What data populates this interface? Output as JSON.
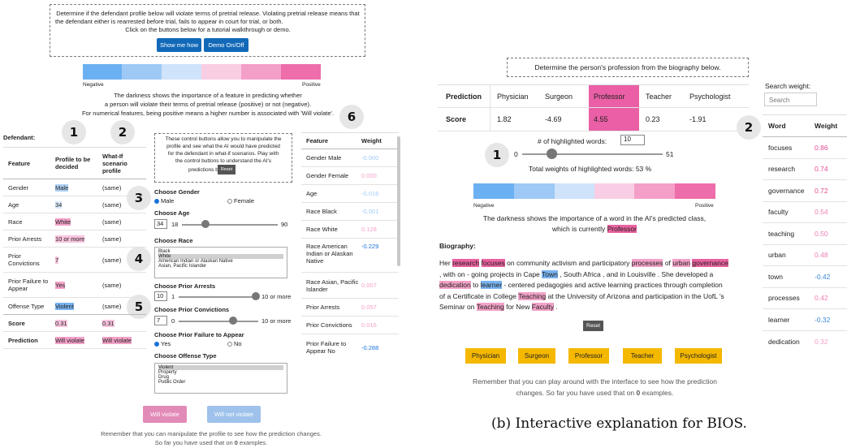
{
  "left": {
    "instructions": {
      "line1": "Determine if the defendant profile below will violate terms of pretrial release. Violating pretrial release means that",
      "line2": "the defendant either is rearrested before trial, fails to appear in court for trial, or both.",
      "line3": "Click on the buttons below for a tutorial walkthrough or demo."
    },
    "show_me_how": "Show me how",
    "demo_toggle": "Demo On/Off",
    "scale": {
      "negative": "Negative",
      "positive": "Positive"
    },
    "darkness_text": {
      "line1": "The darkness shows the importance of a feature in predicting whether",
      "line2": "a person will violate their terms of pretrial release (positive) or not (negative).",
      "line3": "For numerical features, being positive means a higher number is associated with 'Will violate'."
    },
    "defendant_label": "Defendant:",
    "badges": {
      "b1": "1",
      "b2": "2",
      "b3": "3",
      "b4": "4",
      "b5": "5",
      "b6": "6"
    },
    "profile_table": {
      "headers": [
        "Feature",
        "Profile to be decided",
        "What-If scenario profile"
      ],
      "rows": [
        [
          "Gender",
          "Male",
          "(same)"
        ],
        [
          "Age",
          "34",
          "(same)"
        ],
        [
          "Race",
          "White",
          "(same)"
        ],
        [
          "Prior Arrests",
          "10 or more",
          "(same)"
        ],
        [
          "Prior Convictions",
          "7",
          "(same)"
        ],
        [
          "Prior Failure to Appear",
          "Yes",
          "(same)"
        ],
        [
          "Offense Type",
          "Violent",
          "(same)"
        ],
        [
          "Score",
          "0.31",
          "0.31"
        ],
        [
          "Prediction",
          "Will violate",
          "Will violate"
        ]
      ]
    },
    "controls": {
      "hint": {
        "line1": "These control buttons allow you to manipulate the",
        "line2": "profile and see what the AI would have predicted",
        "line3": "for the defendant in what-if scenarios. Play with",
        "line4": "the control buttons to understand the AI's",
        "line5": "predictions better."
      },
      "reset": "Reset",
      "gender_label": "Choose Gender",
      "gender_male": "Male",
      "gender_female": "Female",
      "age_label": "Choose Age",
      "age_value": "34",
      "age_min": "18",
      "age_max": "90",
      "race_label": "Choose Race",
      "race_options": [
        "Black",
        "White",
        "American Indian or Alaskan Native",
        "Asian, Pacific Islander"
      ],
      "arrests_label": "Choose Prior Arrests",
      "arrests_value": "10",
      "arrests_min": "1",
      "arrests_max": "10 or more",
      "convictions_label": "Choose Prior Convictions",
      "convictions_value": "7",
      "convictions_min": "0",
      "convictions_max": "10 or more",
      "fta_label": "Choose Prior Failure to Appear",
      "fta_yes": "Yes",
      "fta_no": "No",
      "offense_label": "Choose Offense Type",
      "offense_options": [
        "Violent",
        "Property",
        "Drug",
        "Public Order"
      ]
    },
    "weights_table": {
      "headers": [
        "Feature",
        "Weight"
      ],
      "rows": [
        [
          "Gender Male",
          "-0.000"
        ],
        [
          "Gender Female",
          "0.000"
        ],
        [
          "Age",
          "-0.016"
        ],
        [
          "Race Black",
          "-0.001"
        ],
        [
          "Race White",
          "0.128"
        ],
        [
          "Race American Indian or Alaskan Native",
          "-0.229"
        ],
        [
          "Race Asian, Pacific Islander",
          "0.007"
        ],
        [
          "Prior Arrests",
          "0.057"
        ],
        [
          "Prior Convictions",
          "0.016"
        ],
        [
          "Prior Failure to Appear No",
          "-0.288"
        ]
      ]
    },
    "will_violate": "Will violate",
    "will_not_violate": "Will not violate",
    "footer": {
      "line1": "Remember that you can manipulate the profile to see how the prediction changes.",
      "line2_pre": "So far you have used that on ",
      "count": "0",
      "line2_post": " examples."
    }
  },
  "right": {
    "instruction": "Determine the person's profession from the biography below.",
    "table": {
      "prediction_label": "Prediction",
      "score_label": "Score",
      "classes": [
        "Physician",
        "Surgeon",
        "Professor",
        "Teacher",
        "Psychologist"
      ],
      "scores": [
        "1.82",
        "-4.69",
        "4.55",
        "0.23",
        "-1.91"
      ]
    },
    "highlight_label": "# of highlighted words:",
    "highlight_value": "10",
    "slider_min": "0",
    "slider_max": "51",
    "total_weights": "Total weights of highlighted words: 53 %",
    "scale": {
      "negative": "Negative",
      "positive": "Positive"
    },
    "darkness_line1": "The darkness shows the importance of a word in the AI's predicted class,",
    "darkness_line2_pre": "which is currently ",
    "darkness_class": "Professor",
    "bio_label": "Biography:",
    "bio": {
      "l1": [
        "Her ",
        "research",
        " ",
        "focuses",
        " on community activism and participatory ",
        "processes",
        " of ",
        "urban",
        " ",
        "governance"
      ],
      "l2": [
        ", with on - going projects in Cape ",
        "Town",
        " , South Africa , and in Louisville . She developed a"
      ],
      "l3": [
        "dedication",
        " to ",
        "learner",
        " - centered pedagogies and active learning practices through completion"
      ],
      "l4": [
        "of a Certificate in College ",
        "Teaching",
        " at the University of Arizona and participation in the UofL 's"
      ],
      "l5": [
        "Seminar on ",
        "Teaching",
        " for New ",
        "Faculty",
        " ."
      ]
    },
    "reset": "Reset",
    "buttons": [
      "Physician",
      "Surgeon",
      "Professor",
      "Teacher",
      "Psychologist"
    ],
    "footer_line1": "Remember that you can play around with the interface to see how the prediction",
    "footer_line2_pre": "changes. So far you have used that on ",
    "footer_count": "0",
    "footer_line2_post": " examples.",
    "search_label": "Search weight:",
    "search_placeholder": "Search",
    "word_table": {
      "headers": [
        "Word",
        "Weight"
      ],
      "rows": [
        [
          "focuses",
          "0.86"
        ],
        [
          "research",
          "0.74"
        ],
        [
          "governance",
          "0.72"
        ],
        [
          "faculty",
          "0.54"
        ],
        [
          "teaching",
          "0.50"
        ],
        [
          "urban",
          "0.48"
        ],
        [
          "town",
          "-0.42"
        ],
        [
          "processes",
          "0.42"
        ],
        [
          "learner",
          "-0.32"
        ],
        [
          "dedication",
          "0.32"
        ]
      ]
    }
  },
  "caption": "(b) Interactive explanation for BIOS.",
  "colors": {
    "pink": "#e9629f",
    "blue": "#7ab3ef",
    "button_blue": "#1269b8",
    "yellow": "#f5b800"
  }
}
